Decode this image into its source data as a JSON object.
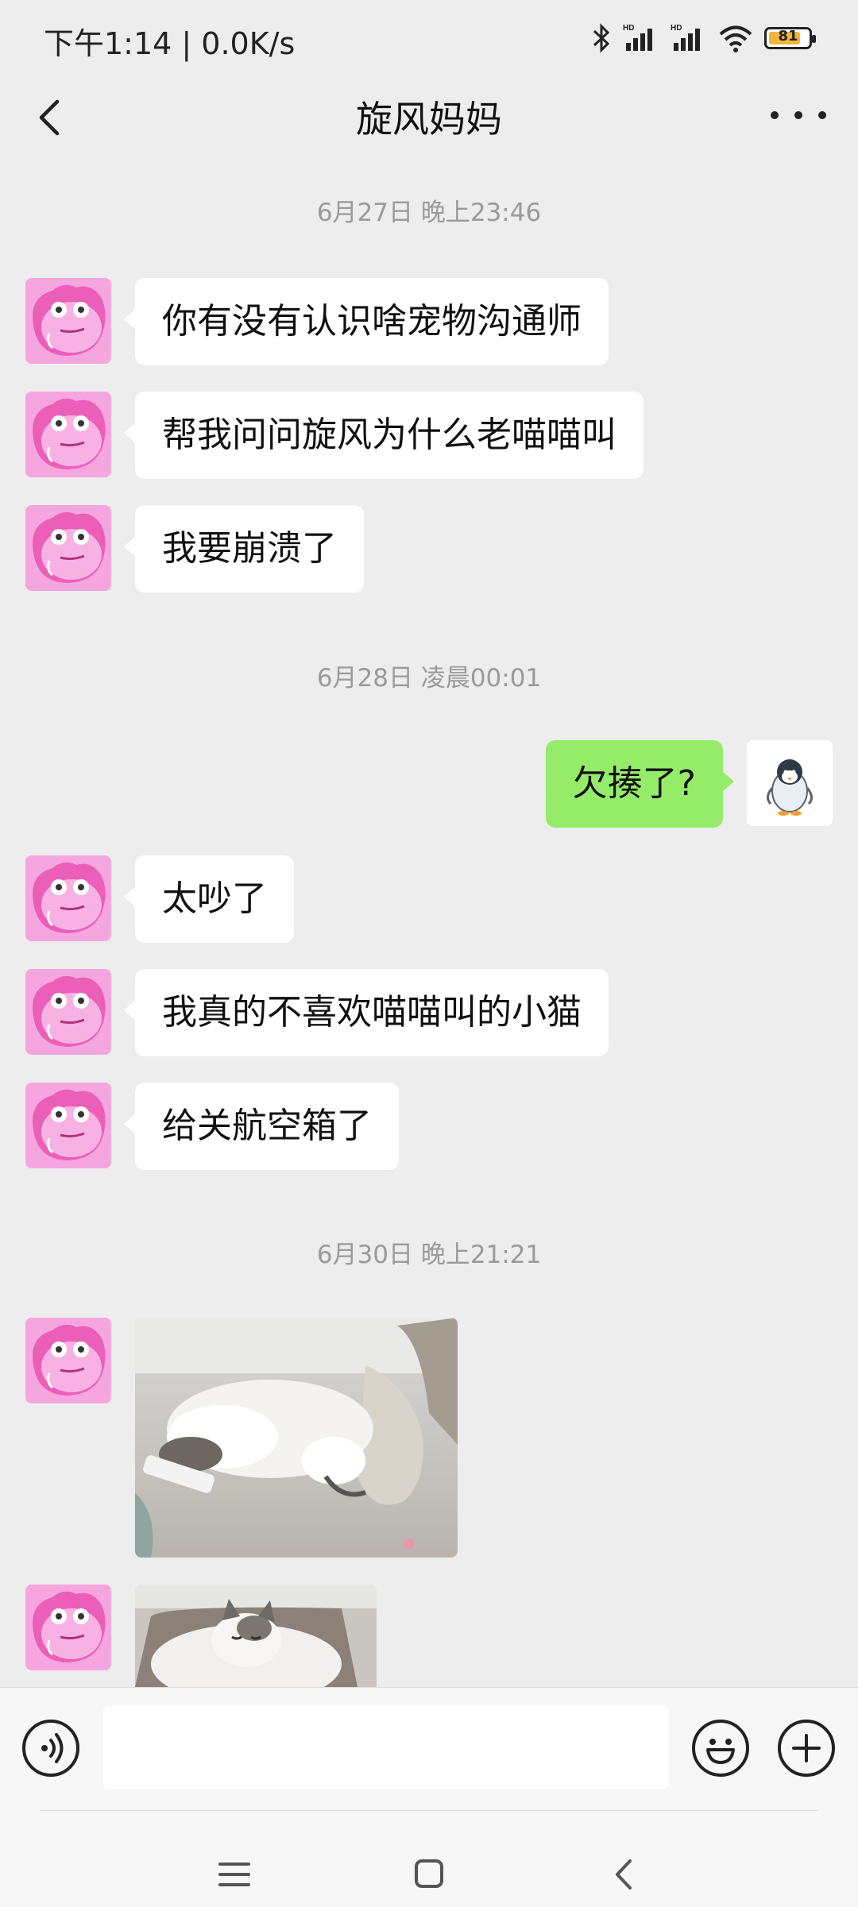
{
  "status_bar": {
    "time": "下午1:14 | 0.0K/s",
    "battery": "81",
    "icons": [
      "bluetooth-icon",
      "hd-signal-icon",
      "hd-signal-icon",
      "wifi-icon",
      "battery-icon"
    ]
  },
  "header": {
    "title": "旋风妈妈",
    "back_icon": "chevron-left-icon",
    "more_icon": "more-dots-icon"
  },
  "chat": {
    "timestamps": [
      "6月27日 晚上23:46",
      "6月28日 凌晨00:01",
      "6月30日 晚上21:21"
    ],
    "messages": [
      {
        "from": "other",
        "text": "你有没有认识啥宠物沟通师"
      },
      {
        "from": "other",
        "text": "帮我问问旋风为什么老喵喵叫"
      },
      {
        "from": "other",
        "text": "我要崩溃了"
      },
      {
        "from": "me",
        "text": "欠揍了?"
      },
      {
        "from": "other",
        "text": "太吵了"
      },
      {
        "from": "other",
        "text": "我真的不喜欢喵喵叫的小猫"
      },
      {
        "from": "other",
        "text": "给关航空箱了"
      },
      {
        "from": "other",
        "type": "image",
        "text": ""
      },
      {
        "from": "other",
        "type": "image",
        "text": ""
      }
    ]
  },
  "input_bar": {
    "voice_icon": "voice-icon",
    "emoji_icon": "emoji-icon",
    "plus_icon": "plus-icon",
    "input_value": ""
  },
  "nav_bar": {
    "icons": [
      "menu-icon",
      "home-icon",
      "back-icon"
    ]
  },
  "colors": {
    "background": "#ededed",
    "outgoing_bubble": "#95ec69",
    "incoming_bubble": "#ffffff",
    "battery": "#f0b63a"
  }
}
